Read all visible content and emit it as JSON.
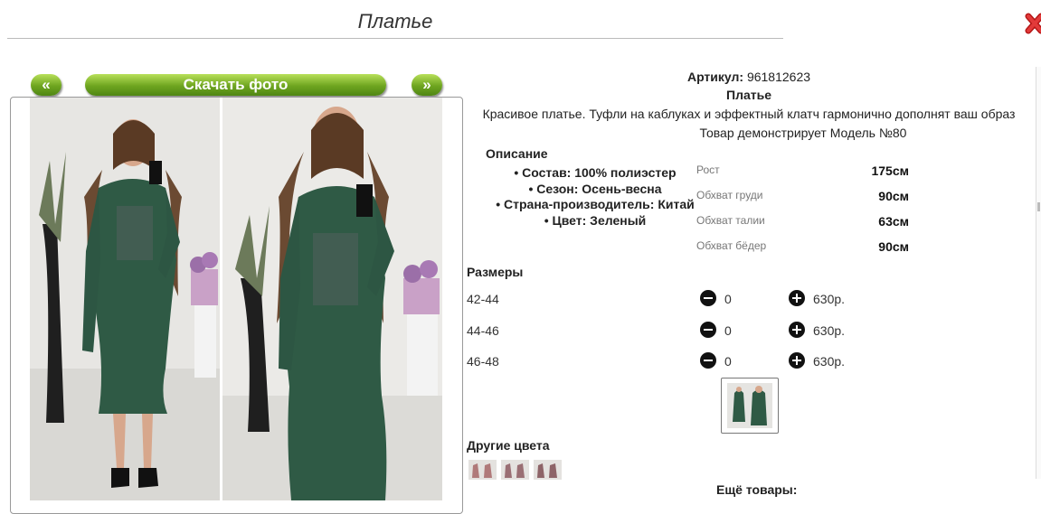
{
  "page": {
    "title": "Платье"
  },
  "nav": {
    "prev_label": "«",
    "download_label": "Скачать фото",
    "next_label": "»"
  },
  "product": {
    "article_label": "Артикул:",
    "article_value": "961812623",
    "name": "Платье",
    "tagline": "Красивое платье. Туфли на каблуках и эффектный клатч гармонично дополнят ваш образ",
    "model_note": "Товар демонстрирует Модель №80"
  },
  "description": {
    "heading": "Описание",
    "items": [
      "• Состав: 100% полиэстер",
      "• Сезон: Осень-весна",
      "• Страна-производитель: Китай",
      "• Цвет: Зеленый"
    ]
  },
  "measurements": [
    {
      "label": "Рост",
      "value": "175см"
    },
    {
      "label": "Обхват груди",
      "value": "90см"
    },
    {
      "label": "Обхват талии",
      "value": "63см"
    },
    {
      "label": "Обхват бёдер",
      "value": "90см"
    }
  ],
  "sizes": {
    "heading": "Размеры",
    "rows": [
      {
        "size": "42-44",
        "qty": "0",
        "price": "630р."
      },
      {
        "size": "44-46",
        "qty": "0",
        "price": "630р."
      },
      {
        "size": "46-48",
        "qty": "0",
        "price": "630р."
      }
    ]
  },
  "other_colors": {
    "heading": "Другие цвета"
  },
  "more_products": {
    "heading": "Ещё товары:"
  },
  "colors": {
    "accent_green": "#6ea51f",
    "dress_green": "#2f5a45",
    "close_red": "#cc1f1f"
  },
  "icons": {
    "close": "close-icon",
    "minus": "minus-circle-icon",
    "plus": "plus-circle-icon"
  }
}
